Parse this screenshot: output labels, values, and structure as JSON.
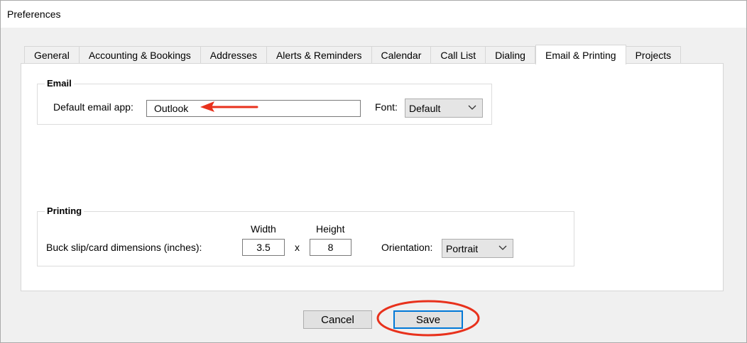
{
  "window": {
    "title": "Preferences"
  },
  "tabs": [
    {
      "id": "general",
      "label": "General",
      "active": false
    },
    {
      "id": "accounting",
      "label": "Accounting & Bookings",
      "active": false
    },
    {
      "id": "addresses",
      "label": "Addresses",
      "active": false
    },
    {
      "id": "alerts",
      "label": "Alerts & Reminders",
      "active": false
    },
    {
      "id": "calendar",
      "label": "Calendar",
      "active": false
    },
    {
      "id": "calllist",
      "label": "Call List",
      "active": false
    },
    {
      "id": "dialing",
      "label": "Dialing",
      "active": false
    },
    {
      "id": "email",
      "label": "Email & Printing",
      "active": true
    },
    {
      "id": "projects",
      "label": "Projects",
      "active": false
    }
  ],
  "email_group": {
    "label": "Email",
    "default_app_label": "Default email app:",
    "default_app_value": "Outlook",
    "font_label": "Font:",
    "font_value": "Default"
  },
  "printing_group": {
    "label": "Printing",
    "dimensions_label": "Buck slip/card dimensions (inches):",
    "width_header": "Width",
    "height_header": "Height",
    "width_value": "3.5",
    "separator": "x",
    "height_value": "8",
    "orientation_label": "Orientation:",
    "orientation_value": "Portrait"
  },
  "buttons": {
    "cancel": "Cancel",
    "save": "Save"
  },
  "colors": {
    "annotation": "#e8311c",
    "focus": "#0078d7"
  },
  "icons": {
    "dropdown": "chevron-down-icon",
    "annotation_arrow": "arrow-left-icon",
    "annotation_circle": "highlight-ellipse-icon"
  }
}
